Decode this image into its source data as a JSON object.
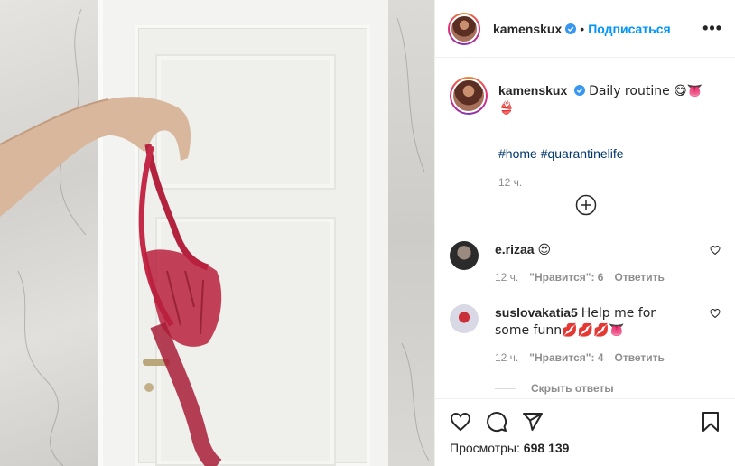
{
  "post": {
    "username": "kamenskux",
    "follow_label": "Подписаться",
    "dot": "•",
    "more_label": "•••",
    "caption_text": "Daily routine 😋👅👙",
    "hashtags": "#home #quarantinelife",
    "caption_time": "12 ч."
  },
  "comments": [
    {
      "username": "e.rizaa",
      "text": "😍",
      "time": "12 ч.",
      "likes": "\"Нравится\": 6",
      "reply_label": "Ответить"
    },
    {
      "username": "suslovakatia5",
      "text": "Help me for some funn💋💋💋👅",
      "time": "12 ч.",
      "likes": "\"Нравится\": 4",
      "reply_label": "Ответить",
      "hide_replies": "Скрыть ответы"
    }
  ],
  "stats": {
    "views_label": "Просмотры:",
    "views_count": "698 139"
  },
  "colors": {
    "accent": "#0095f6",
    "hashtag": "#00376b",
    "muted": "#8e8e8e"
  },
  "icons": [
    "heart-icon",
    "comment-icon",
    "share-icon",
    "bookmark-icon",
    "more-icon",
    "verified-icon",
    "load-more-icon"
  ]
}
